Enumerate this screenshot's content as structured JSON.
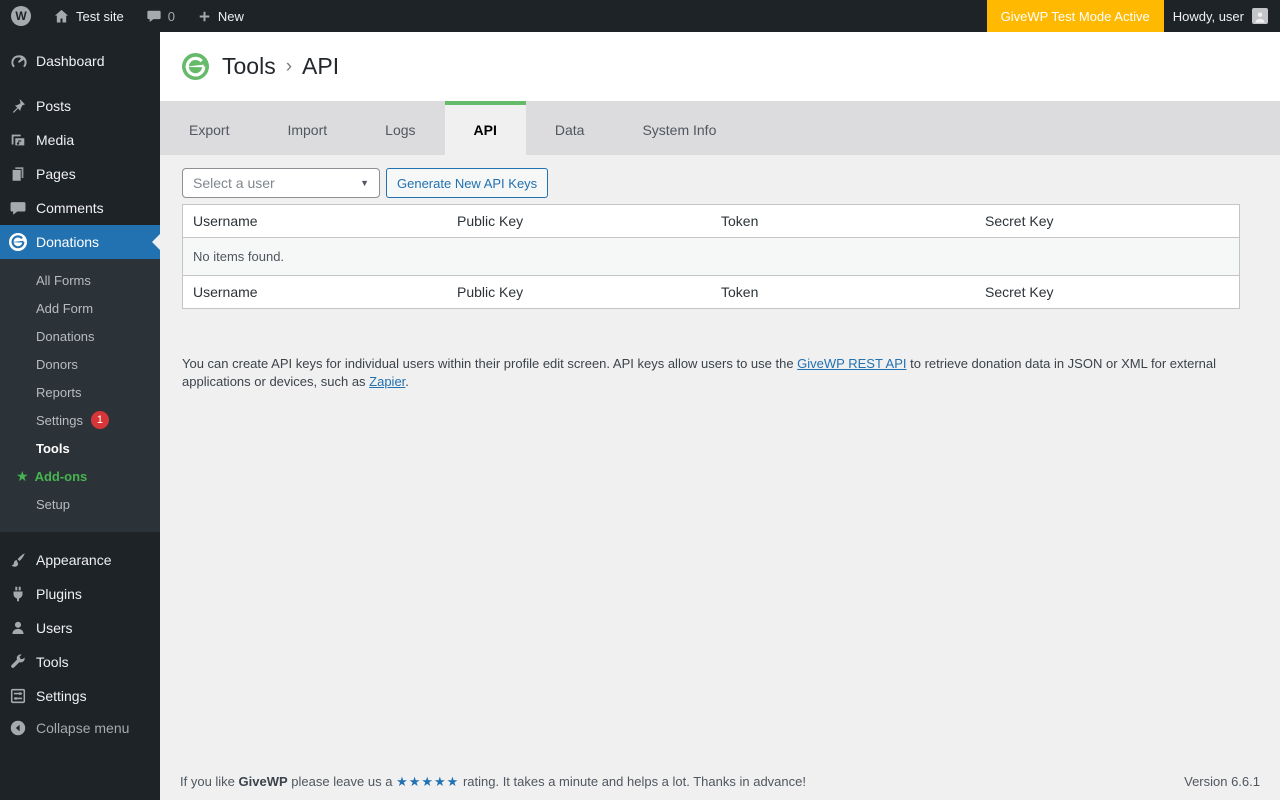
{
  "admin_bar": {
    "wordpress_logo_glyph": "W",
    "site_name": "Test site",
    "comments_count": "0",
    "new_label": "New",
    "test_mode_badge": "GiveWP Test Mode Active",
    "howdy": "Howdy, user"
  },
  "sidebar": {
    "dashboard": "Dashboard",
    "posts": "Posts",
    "media": "Media",
    "pages": "Pages",
    "comments": "Comments",
    "donations": "Donations",
    "submenu": {
      "all_forms": "All Forms",
      "add_form": "Add Form",
      "donations": "Donations",
      "donors": "Donors",
      "reports": "Reports",
      "settings": "Settings",
      "settings_badge": "1",
      "tools": "Tools",
      "addons_star": "★",
      "addons": "Add-ons",
      "setup": "Setup"
    },
    "appearance": "Appearance",
    "plugins": "Plugins",
    "users": "Users",
    "tools": "Tools",
    "settings": "Settings",
    "collapse": "Collapse menu"
  },
  "header": {
    "breadcrumb_parent": "Tools",
    "breadcrumb_separator": "›",
    "breadcrumb_current": "API"
  },
  "tabs": {
    "export": "Export",
    "import": "Import",
    "logs": "Logs",
    "api": "API",
    "data": "Data",
    "system_info": "System Info",
    "active_tab": "API"
  },
  "controls": {
    "user_select_value": "Select a user",
    "select_chevron": "▼",
    "generate_button": "Generate New API Keys"
  },
  "table": {
    "columns": [
      "Username",
      "Public Key",
      "Token",
      "Secret Key"
    ],
    "empty_message": "No items found."
  },
  "description": {
    "text_1": "You can create API keys for individual users within their profile edit screen. API keys allow users to use the ",
    "link_rest_api": "GiveWP REST API",
    "text_2": " to retrieve donation data in JSON or XML for external applications or devices, such as ",
    "link_zapier": "Zapier",
    "text_3": "."
  },
  "footer": {
    "like_prefix": "If you like ",
    "plugin_name": "GiveWP",
    "like_middle": " please leave us a ",
    "stars": "★★★★★",
    "like_suffix": " rating. It takes a minute and helps a lot. Thanks in advance!",
    "version": "Version 6.6.1"
  },
  "colors": {
    "accent_green": "#66bb6a",
    "wp_blue": "#2271b1",
    "test_mode_orange": "#ffb900",
    "badge_red": "#d63638",
    "addons_green": "#46b450"
  }
}
